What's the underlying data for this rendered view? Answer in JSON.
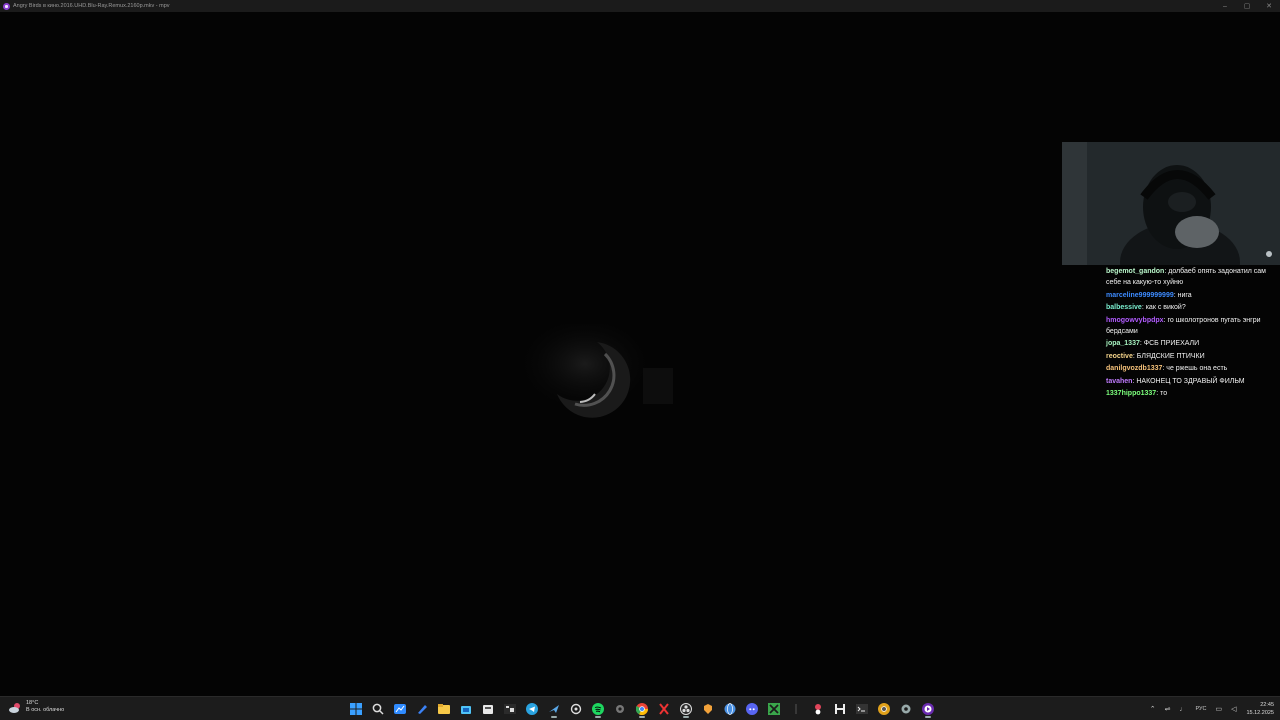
{
  "window": {
    "title": "Angry Birds в кино.2016.UHD.Blu-Ray.Remux.2160p.mkv - mpv",
    "controls": [
      "–",
      "▢",
      "✕"
    ]
  },
  "chat": {
    "messages": [
      {
        "user": "begemot_gandon",
        "color": "#b9f6ca",
        "text": "долбаеб опять задонатил сам себе на какую-то хуйню"
      },
      {
        "user": "marceline999999999",
        "color": "#3d8bff",
        "text": "нига"
      },
      {
        "user": "balbessive",
        "color": "#7cf0d1",
        "text": "как с викой?"
      },
      {
        "user": "hmogowvybpdpx",
        "color": "#b25cff",
        "text": "го школотронов пугать энгри бердсами"
      },
      {
        "user": "jopa_1337",
        "color": "#a7f3c0",
        "text": "ФСБ ПРИЕХАЛИ"
      },
      {
        "user": "reoctive",
        "color": "#f6d58b",
        "text": "БЛЯДСКИЕ ПТИЧКИ"
      },
      {
        "user": "danilgvozdb1337",
        "color": "#f6c27a",
        "text": "че ржешь она есть"
      },
      {
        "user": "tavahen",
        "color": "#c07cff",
        "text": "НАКОНЕЦ ТО ЗДРАВЫЙ ФИЛЬМ"
      },
      {
        "user": "1337hippo1337",
        "color": "#7cff7c",
        "text": "то"
      }
    ]
  },
  "weather": {
    "temp": "18°C",
    "desc": "В осн. облачно"
  },
  "taskbar": {
    "icons": [
      "windows-start-icon",
      "search-icon",
      "widgets-icon",
      "editor-icon",
      "file-explorer-icon",
      "store-icon",
      "mail-icon",
      "terminal-icon",
      "telegram-icon",
      "steam-icon",
      "chatgpt-icon",
      "spotify-icon",
      "settings-gear-icon",
      "chrome-icon",
      "app-x-icon",
      "obs-icon",
      "app-shield-icon",
      "app-globe-icon",
      "discord-icon",
      "minecraft-icon",
      "separator-icon",
      "app-red-icon",
      "app-h-icon",
      "terminal2-icon",
      "chrome-dev-icon",
      "gear2-icon",
      "mpv-icon"
    ],
    "tray": {
      "lang": "РУС"
    },
    "clock": {
      "time": "22:45",
      "date": "15.12.2025"
    }
  }
}
